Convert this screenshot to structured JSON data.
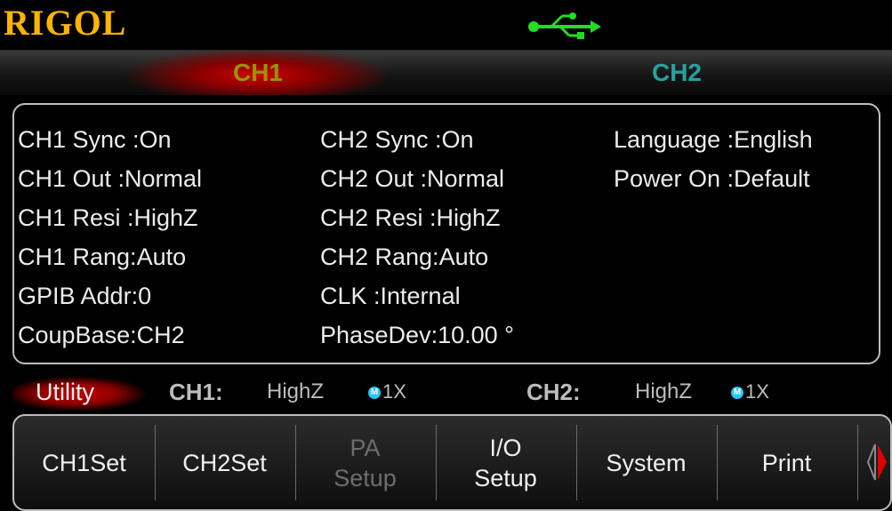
{
  "header": {
    "brand": "RIGOL",
    "usb_icon": "usb-icon",
    "usb_color": "#22dd22"
  },
  "tabs": [
    {
      "label": "CH1",
      "active": true
    },
    {
      "label": "CH2",
      "active": false
    }
  ],
  "info": {
    "col1": [
      "CH1 Sync :On",
      "CH1 Out   :Normal",
      "CH1 Resi  :HighZ",
      "CH1 Rang:Auto",
      "GPIB Addr:0",
      "CoupBase:CH2"
    ],
    "col2": [
      "CH2 Sync :On",
      "CH2 Out   :Normal",
      "CH2 Resi  :HighZ",
      "CH2 Rang:Auto",
      "CLK         :Internal",
      "PhaseDev:10.00 °"
    ],
    "col3": [
      "Language :English",
      "Power On :Default"
    ]
  },
  "status": {
    "mode": "Utility",
    "ch1_label": "CH1:",
    "ch1_impedance": "HighZ",
    "ch1_mult": "1X",
    "ch2_label": "CH2:",
    "ch2_impedance": "HighZ",
    "ch2_mult": "1X",
    "m_icon": "M"
  },
  "menu": [
    {
      "label": "CH1Set",
      "enabled": true
    },
    {
      "label": "CH2Set",
      "enabled": true
    },
    {
      "label": "PA\nSetup",
      "line1": "PA",
      "line2": "Setup",
      "enabled": false
    },
    {
      "label": "I/O\nSetup",
      "line1": "I/O",
      "line2": "Setup",
      "enabled": true
    },
    {
      "label": "System",
      "enabled": true
    },
    {
      "label": "Print",
      "enabled": true
    }
  ],
  "colors": {
    "brand": "#ffb400",
    "active_tab_text": "#9a9400",
    "ch2_tab_text": "#2aa0a0",
    "highlight_red": "#c00000",
    "page_arrow": "#e00000"
  }
}
